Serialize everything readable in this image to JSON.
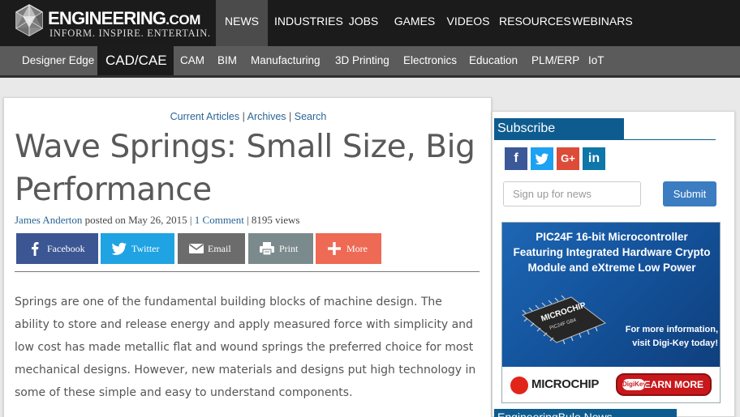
{
  "site": {
    "logo_name": "ENGINEERING",
    "logo_com": ".COM",
    "tagline": "INFORM. INSPIRE. ENTERTAIN."
  },
  "main_nav": [
    "NEWS",
    "INDUSTRIES",
    "JOBS",
    "GAMES",
    "VIDEOS",
    "RESOURCES",
    "WEBINARS"
  ],
  "main_nav_active": "NEWS",
  "sub_nav": [
    "Designer Edge",
    "CAD/CAE",
    "CAM",
    "BIM",
    "Manufacturing",
    "3D Printing",
    "Electronics",
    "Education",
    "PLM/ERP",
    "IoT"
  ],
  "sub_nav_active": "CAD/CAE",
  "breadcrumbs": {
    "current": "Current Articles",
    "sep1": " | ",
    "archives": "Archives",
    "sep2": " | ",
    "search": "Search"
  },
  "article": {
    "title": "Wave Springs: Small Size, Big Performance",
    "author": "James Anderton",
    "posted_on": " posted on May 26, 2015 | ",
    "comments": "1 Comment",
    "views": " | 8195 views",
    "body": "Springs are one of the fundamental building blocks of machine design. The ability to store and release energy and apply measured force with simplicity and low cost has made metallic flat and wound springs the preferred choice for most mechanical designs. However, new materials and designs put high technology in some of these simple and easy to understand components."
  },
  "share_buttons": {
    "facebook": "Facebook",
    "twitter": "Twitter",
    "email": "Email",
    "print": "Print",
    "more": "More"
  },
  "sidebar": {
    "subscribe_heading": "Subscribe",
    "social": {
      "facebook": "f",
      "twitter": "t",
      "google": "G+",
      "linkedin": "in"
    },
    "signup_placeholder": "Sign up for news",
    "submit_label": "Submit",
    "ad": {
      "headline_1": "PIC24F 16-bit Microcontroller",
      "headline_2": "Featuring Integrated Hardware Crypto",
      "headline_3": "Module and eXtreme Low Power",
      "chip_brand": "MICROCHIP",
      "chip_model": "PIC24F  GB4",
      "cta_1": "For more information,",
      "cta_2": "visit Digi-Key today!",
      "brand": "MICROCHIP",
      "learn_more": "LEARN MORE",
      "distributor": "DigiKey"
    },
    "next_heading": "EngineeringBule News"
  },
  "colors": {
    "topbar": "#1b1b1b",
    "subnav": "#5b5b5b",
    "link": "#2a6496",
    "sidebar_heading": "#0e5c8f",
    "facebook": "#3b5693",
    "twitter": "#1fa3e3",
    "email": "#6c6c6c",
    "print": "#7b8a8c",
    "more": "#ee6a55",
    "submit": "#3c7cc1"
  }
}
